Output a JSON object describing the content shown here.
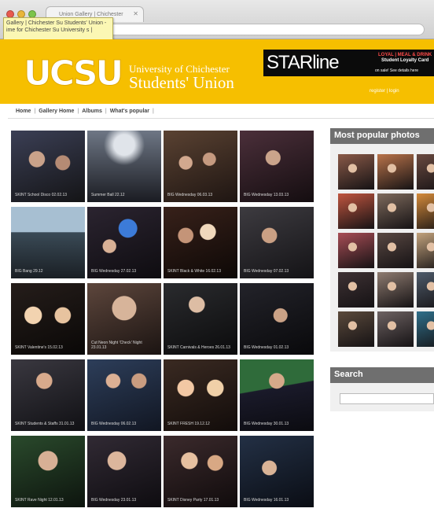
{
  "browser": {
    "tab_title": "Union Gallery | Chichester",
    "tooltip": "Gallery | Chichester Su Students' Union - ime for Chichester Su University s |"
  },
  "header": {
    "logo_text": "UCSU",
    "university_line": "University of Chichester",
    "union_line": "Students' Union",
    "banner_brand": "STARline",
    "banner_line1": "LOYAL | MEAL & DRINK",
    "banner_line2": "Student Loyalty Card",
    "banner_line3": "on sale! See details here",
    "register_link": "register | login"
  },
  "nav": [
    "Home",
    "Gallery Home",
    "Albums",
    "What's popular"
  ],
  "gallery": [
    {
      "caption": "SKINT School Disco 02.02.13"
    },
    {
      "caption": "Summer Ball 22.12"
    },
    {
      "caption": "BIG Wednesday 06.03.13"
    },
    {
      "caption": "BIG Wednesday 13.03.13"
    },
    {
      "caption": "BIG Bang 29.12"
    },
    {
      "caption": "BIG Wednesday 27.02.13"
    },
    {
      "caption": "SKINT Black & White 16.02.13"
    },
    {
      "caption": "BIG Wednesday 07.02.13"
    },
    {
      "caption": "SKINT Valentine's 15.02.13"
    },
    {
      "caption": "Cut Neon Night 'Check' Night 23.01.13"
    },
    {
      "caption": "SKINT Carnivals & Heroes 26.01.13"
    },
    {
      "caption": "BIG Wednesday 01.02.13"
    },
    {
      "caption": "SKINT Students & Staffs 31.01.13"
    },
    {
      "caption": "BIG Wednesday 06.02.13"
    },
    {
      "caption": "SKINT FRESH 19.12.12"
    },
    {
      "caption": "BIG Wednesday 30.01.13"
    },
    {
      "caption": "SKINT Rave Night 12.01.13"
    },
    {
      "caption": "BIG Wednesday 23.01.13"
    },
    {
      "caption": "SKINT Disney Party 17.01.13"
    },
    {
      "caption": "BIG Wednesday 16.01.13"
    }
  ],
  "sidebar": {
    "popular_title": "Most popular photos",
    "search_title": "Search"
  },
  "colors": {
    "brand_yellow": "#f6bf00",
    "panel_grey": "#6f6f6f"
  }
}
